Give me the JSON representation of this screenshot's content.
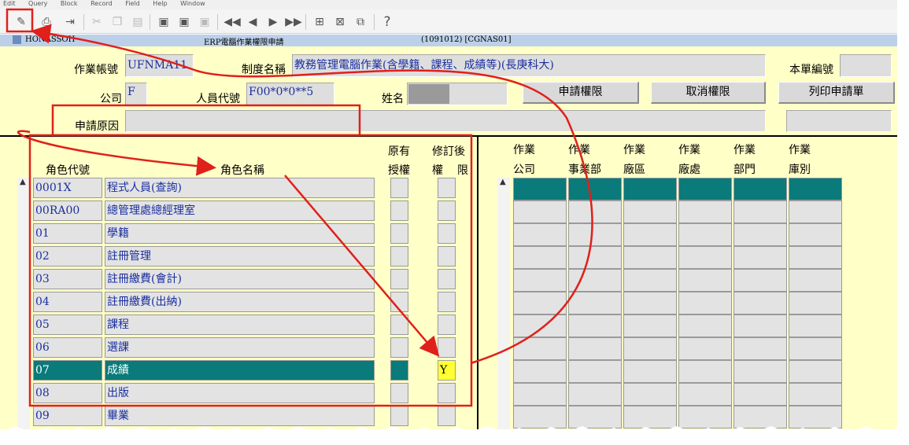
{
  "menubar": [
    "Edit",
    "Query",
    "Block",
    "Record",
    "Field",
    "Help",
    "Window"
  ],
  "toolbar": {
    "icons": [
      "save-icon",
      "print-icon",
      "exit-icon",
      "cut-icon",
      "copy-icon",
      "paste-icon",
      "enter-query-icon",
      "execute-query-icon",
      "cancel-query-icon",
      "first-record-icon",
      "previous-record-icon",
      "next-record-icon",
      "last-record-icon",
      "insert-record-icon",
      "delete-record-icon",
      "duplicate-record-icon",
      "help-icon"
    ],
    "help_glyph": "?"
  },
  "titlebar": {
    "app_code": "HONASSOH",
    "title": "ERP電腦作業權限申請",
    "info": "(1091012) [CGNAS01]"
  },
  "form": {
    "account_label": "作業帳號",
    "account_value": "UFNMA11",
    "system_label": "制度名稱",
    "system_value": "教務管理電腦作業(含學籍、課程、成績等)(長庚科大)",
    "doc_no_label": "本單編號",
    "doc_no_value": "",
    "company_label": "公司",
    "company_value": "F",
    "person_label": "人員代號",
    "person_value": "F00*0*0**5",
    "name_label": "姓名",
    "name_value": "",
    "reason_label": "申請原因",
    "reason_value": ""
  },
  "buttons": {
    "apply": "申請權限",
    "cancel": "取消權限",
    "print": "列印申請單"
  },
  "roles": {
    "headers": {
      "code": "角色代號",
      "name": "角色名稱",
      "orig_1": "原有",
      "orig_2": "授權",
      "rev_1": "修訂後",
      "rev_2a": "權",
      "rev_2b": "限"
    },
    "rows": [
      {
        "code": "0001X",
        "name": "程式人員(查詢)",
        "rev": ""
      },
      {
        "code": "00RA00",
        "name": "總管理處總經理室",
        "rev": ""
      },
      {
        "code": "01",
        "name": "學籍",
        "rev": ""
      },
      {
        "code": "02",
        "name": "註冊管理",
        "rev": ""
      },
      {
        "code": "03",
        "name": "註冊繳費(會計)",
        "rev": ""
      },
      {
        "code": "04",
        "name": "註冊繳費(出納)",
        "rev": ""
      },
      {
        "code": "05",
        "name": "課程",
        "rev": ""
      },
      {
        "code": "06",
        "name": "選課",
        "rev": ""
      },
      {
        "code": "07",
        "name": "成績",
        "rev": "Y"
      },
      {
        "code": "08",
        "name": "出版",
        "rev": ""
      },
      {
        "code": "09",
        "name": "畢業",
        "rev": ""
      }
    ]
  },
  "scope": {
    "headers": [
      {
        "top": "作業",
        "bottom": "公司"
      },
      {
        "top": "作業",
        "bottom": "事業部"
      },
      {
        "top": "作業",
        "bottom": "廠區"
      },
      {
        "top": "作業",
        "bottom": "廠處"
      },
      {
        "top": "作業",
        "bottom": "部門"
      },
      {
        "top": "作業",
        "bottom": "庫別"
      }
    ],
    "row_count": 11
  },
  "colors": {
    "form_bg": "#ffffc8",
    "selected_row": "#0a7a7a",
    "annotation": "#e0201a",
    "field_text": "#1a2fa0"
  }
}
